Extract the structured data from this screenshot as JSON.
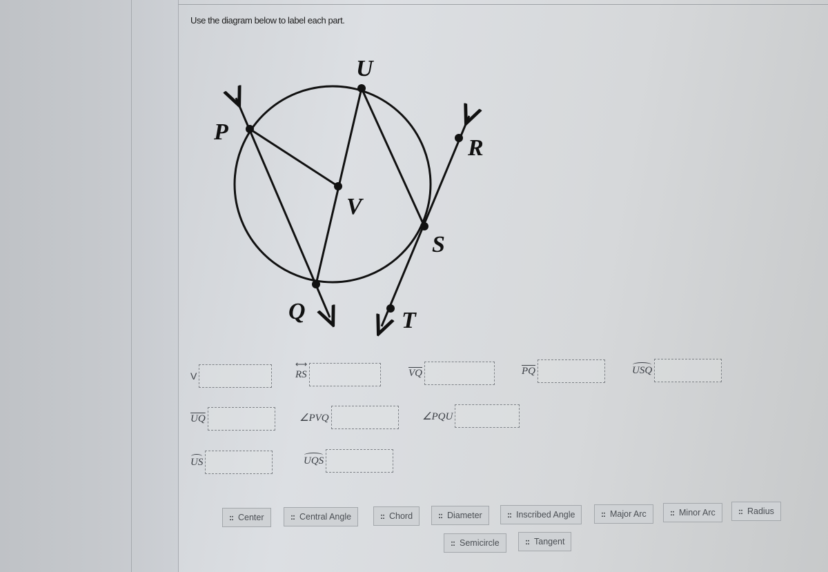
{
  "instruction": "Use the diagram below to label each part.",
  "diagram": {
    "points": {
      "U": "U",
      "P": "P",
      "R": "R",
      "V": "V",
      "S": "S",
      "Q": "Q",
      "T": "T"
    }
  },
  "fields": [
    {
      "label": "V",
      "kind": "point",
      "value": ""
    },
    {
      "label": "RS",
      "kind": "line",
      "value": ""
    },
    {
      "label": "VQ",
      "kind": "segment",
      "value": ""
    },
    {
      "label": "PQ",
      "kind": "segment",
      "value": ""
    },
    {
      "label": "USQ",
      "kind": "arc",
      "value": ""
    },
    {
      "label": "UQ",
      "kind": "segment",
      "value": ""
    },
    {
      "label": "∠PVQ",
      "kind": "angle",
      "value": ""
    },
    {
      "label": "∠PQU",
      "kind": "angle",
      "value": ""
    },
    {
      "label": "US",
      "kind": "arc",
      "value": ""
    },
    {
      "label": "UQS",
      "kind": "arc",
      "value": ""
    }
  ],
  "answer_bank": {
    "grip_icon": "::",
    "options": [
      "Center",
      "Central Angle",
      "Chord",
      "Diameter",
      "Inscribed Angle",
      "Major Arc",
      "Minor Arc",
      "Radius",
      "Semicircle",
      "Tangent"
    ]
  }
}
